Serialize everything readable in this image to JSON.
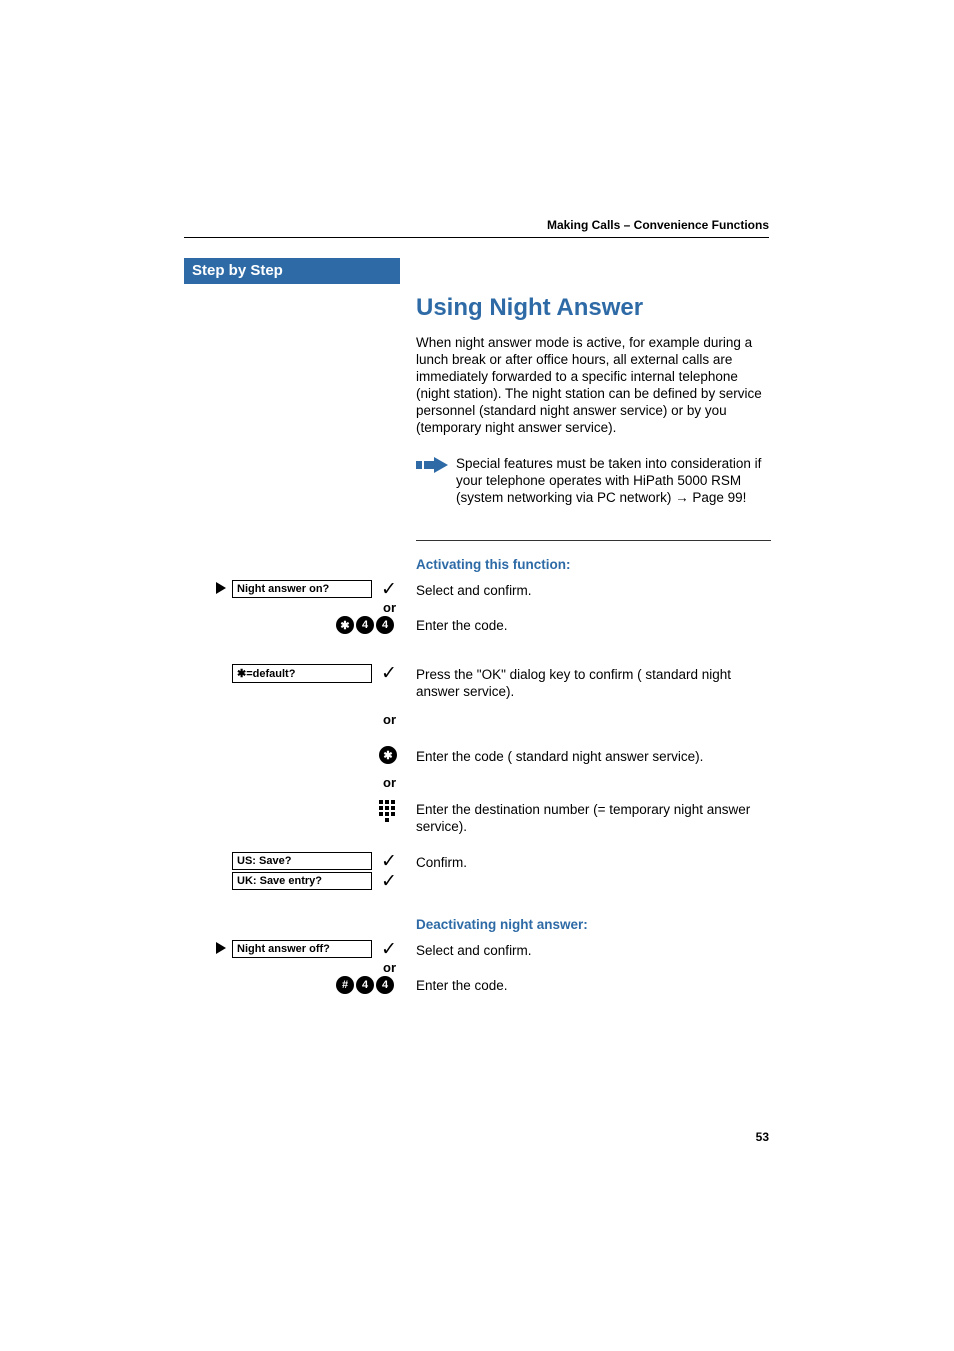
{
  "header": "Making Calls – Convenience Functions",
  "stepByStep": "Step by Step",
  "title": "Using Night Answer",
  "intro": "When night answer mode is active, for example during a lunch break or after office hours, all external calls are immediately forwarded to a specific internal telephone (night station). The night station can be defined by service personnel (standard night answer service) or by you (temporary night answer service).",
  "note": "Special features must be taken into consideration if your telephone operates with HiPath 5000 RSM (system networking via PC network) → Page 99!",
  "activating_heading": "Activating this function:",
  "select_confirm": "Select and confirm.",
  "or": "or",
  "enter_code": "Enter the code.",
  "press_ok": "Press the \"OK\" dialog key to confirm ( standard night answer service).",
  "enter_code_std": "Enter the code ( standard night answer service).",
  "enter_dest": "Enter the destination number (= temporary night answer service).",
  "confirm": "Confirm.",
  "deactivating_heading": "Deactivating night answer:",
  "displays": {
    "night_on": "Night answer on?",
    "default": "✱=default?",
    "us_save": "US: Save?",
    "uk_save": "UK: Save entry?",
    "night_off": "Night answer off?"
  },
  "keys": {
    "star": "✱",
    "hash": "#",
    "k4": "4"
  },
  "pageNum": "53"
}
